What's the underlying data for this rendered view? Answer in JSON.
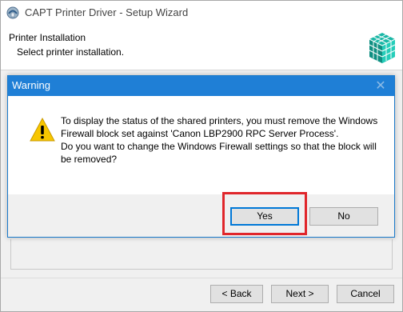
{
  "window": {
    "title": "CAPT Printer Driver - Setup Wizard",
    "header_title": "Printer Installation",
    "header_subtitle": "Select printer installation.",
    "buttons": {
      "back": "< Back",
      "next": "Next >",
      "cancel": "Cancel"
    }
  },
  "dialog": {
    "title": "Warning",
    "close_glyph": "✕",
    "message_line1": "To display the status of the shared printers, you must remove the Windows Firewall block set against 'Canon LBP2900 RPC Server Process'.",
    "message_line2": "Do you want to change the Windows Firewall settings so that the block will be removed?",
    "buttons": {
      "yes": "Yes",
      "no": "No"
    }
  },
  "colors": {
    "dialog_titlebar": "#1f7fd6",
    "highlight": "#e0262b",
    "warning_yellow": "#f7c600"
  },
  "icons": [
    "app-installer-icon",
    "wizard-header-art",
    "warning-icon",
    "close-icon"
  ]
}
